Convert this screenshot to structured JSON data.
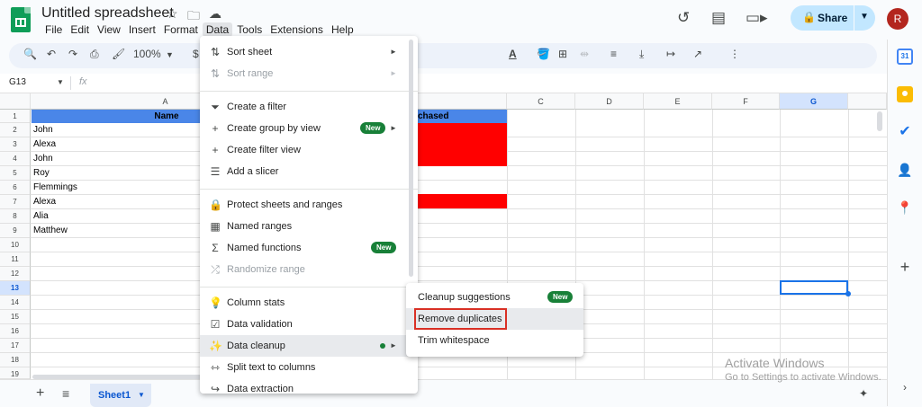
{
  "app": {
    "title": "Untitled spreadsheet",
    "menus": [
      "File",
      "Edit",
      "View",
      "Insert",
      "Format",
      "Data",
      "Tools",
      "Extensions",
      "Help"
    ],
    "active_menu": "Data",
    "share_label": "Share",
    "avatar_letter": "R"
  },
  "toolbar": {
    "zoom": "100%",
    "currency_symbol": "$"
  },
  "formula_bar": {
    "name_box": "G13",
    "fx": "fx"
  },
  "grid": {
    "columns": [
      "A",
      "",
      "",
      "C",
      "D",
      "E",
      "F",
      "G"
    ],
    "selected_column": "G",
    "rows": [
      "1",
      "2",
      "3",
      "4",
      "5",
      "6",
      "7",
      "8",
      "9",
      "10",
      "11",
      "12",
      "13",
      "14",
      "15",
      "16",
      "17",
      "18",
      "19"
    ],
    "selected_row": "13",
    "header_a": "Name",
    "header_partial": "chased",
    "names": [
      "John",
      "Alexa",
      "John",
      "Roy",
      "Flemmings",
      "Alexa",
      "Alia",
      "Matthew"
    ]
  },
  "sheets": {
    "active": "Sheet1"
  },
  "data_menu": {
    "items": [
      {
        "label": "Sort sheet",
        "icon": "sort-icon",
        "arrow": "►",
        "disabled": false
      },
      {
        "label": "Sort range",
        "icon": "sort-icon",
        "arrow": "►",
        "disabled": true
      },
      {
        "label": "Create a filter",
        "icon": "filter-icon",
        "disabled": false
      },
      {
        "label": "Create group by view",
        "icon": "plus-icon",
        "badge": "New",
        "arrow": "►",
        "disabled": false
      },
      {
        "label": "Create filter view",
        "icon": "plus-icon",
        "disabled": false
      },
      {
        "label": "Add a slicer",
        "icon": "slicer-icon",
        "disabled": false
      },
      {
        "label": "Protect sheets and ranges",
        "icon": "lock-icon",
        "disabled": false
      },
      {
        "label": "Named ranges",
        "icon": "named-range-icon",
        "disabled": false
      },
      {
        "label": "Named functions",
        "icon": "sigma-icon",
        "badge": "New",
        "disabled": false
      },
      {
        "label": "Randomize range",
        "icon": "shuffle-icon",
        "disabled": true
      },
      {
        "label": "Column stats",
        "icon": "bulb-icon",
        "disabled": false
      },
      {
        "label": "Data validation",
        "icon": "validation-icon",
        "disabled": false
      },
      {
        "label": "Data cleanup",
        "icon": "magic-wand-icon",
        "arrow": "►",
        "disabled": false
      },
      {
        "label": "Split text to columns",
        "icon": "split-icon",
        "disabled": false
      },
      {
        "label": "Data extraction",
        "icon": "extraction-icon",
        "disabled": false
      }
    ]
  },
  "cleanup_submenu": {
    "items": [
      {
        "label": "Cleanup suggestions",
        "badge": "New"
      },
      {
        "label": "Remove duplicates"
      },
      {
        "label": "Trim whitespace"
      }
    ]
  },
  "watermark": {
    "line1": "Activate Windows",
    "line2": "Go to Settings to activate Windows."
  },
  "colors": {
    "header_fill": "#4a86e8",
    "highlight_red": "#ff0000",
    "accent": "#1a73e8",
    "badge_green": "#188038",
    "annotation_red": "#d93025"
  }
}
